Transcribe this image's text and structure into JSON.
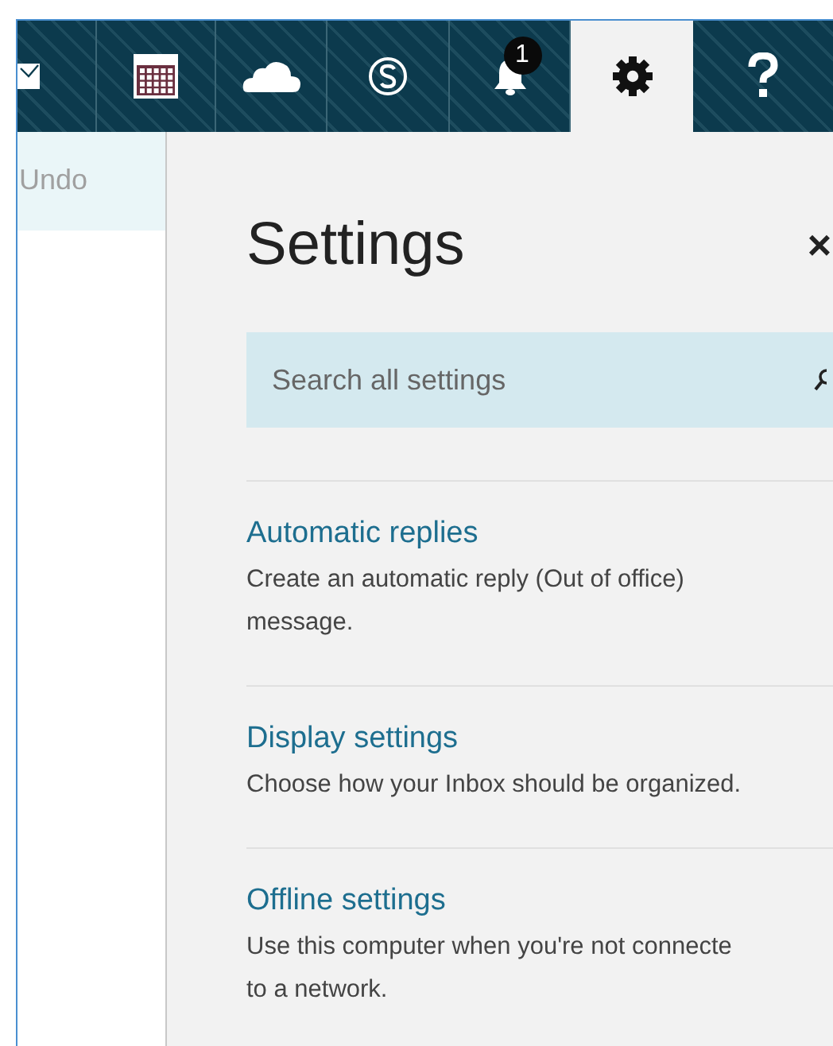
{
  "header_tabs": [
    {
      "kind": "mail",
      "selected": false
    },
    {
      "kind": "calendar",
      "selected": false
    },
    {
      "kind": "cloud",
      "selected": false
    },
    {
      "kind": "skype",
      "selected": false
    },
    {
      "kind": "bell",
      "selected": false,
      "badge": "1"
    },
    {
      "kind": "gear",
      "selected": true
    },
    {
      "kind": "help",
      "selected": false
    }
  ],
  "left_pane": {
    "undo": "Undo"
  },
  "settings_panel": {
    "title": "Settings",
    "close": "×",
    "search": {
      "placeholder": "Search all settings"
    },
    "items": [
      {
        "title": "Automatic replies",
        "description_lines": [
          "Create an automatic reply (Out of office)",
          "message."
        ]
      },
      {
        "title": "Display settings",
        "description_lines": [
          "Choose how your Inbox should be organized."
        ]
      },
      {
        "title": "Offline settings",
        "description_lines": [
          "Use this computer when you're not connecte",
          "to a network."
        ]
      }
    ]
  }
}
